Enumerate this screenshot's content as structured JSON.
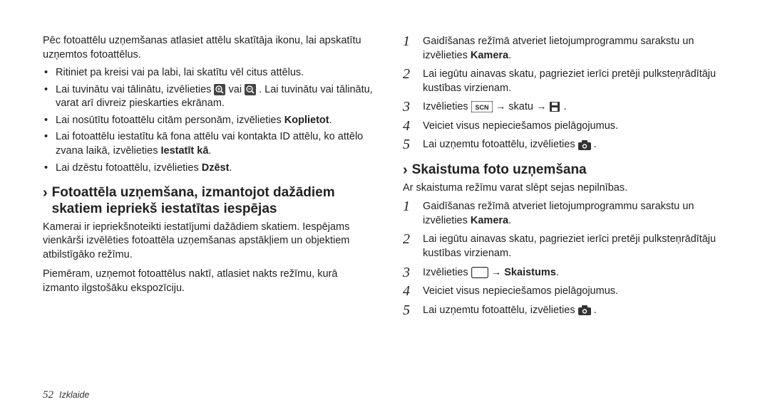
{
  "left": {
    "intro": "Pēc fotoattēlu uzņemšanas atlasiet attēlu skatītāja ikonu, lai apskatītu uzņemtos fotoattēlus.",
    "bullets": {
      "b1": "Ritiniet pa kreisi vai pa labi, lai skatītu vēl citus attēlus.",
      "b2a": "Lai tuvinātu vai tālinātu, izvēlieties ",
      "b2b": " vai ",
      "b2c": ". Lai tuvinātu vai tālinātu, varat arī divreiz pieskarties ekrānam.",
      "b3a": "Lai nosūtītu fotoattēlu citām personām, izvēlieties ",
      "b3b": "Koplietot",
      "b3c": ".",
      "b4a": "Lai fotoattēlu iestatītu kā fona attēlu vai kontakta ID attēlu, ko attēlo zvana laikā, izvēlieties ",
      "b4b": "Iestatīt kā",
      "b4c": ".",
      "b5a": "Lai dzēstu fotoattēlu, izvēlieties ",
      "b5b": "Dzēst",
      "b5c": "."
    },
    "subhead": "Fotoattēla uzņemšana, izmantojot dažādiem skatiem iepriekš iestatītas iespējas",
    "after1": "Kamerai ir iepriekšnoteikti iestatījumi dažādiem skatiem. Iespējams vienkārši izvēlēties fotoattēla uzņemšanas apstākļiem un objektiem atbilstīgāko režīmu.",
    "after2": "Piemēram, uzņemot fotoattēlus naktī, atlasiet nakts režīmu, kurā izmanto ilgstošāku ekspozīciju."
  },
  "right": {
    "stepsA": {
      "s1a": "Gaidīšanas režīmā atveriet lietojumprogrammu sarakstu un izvēlieties ",
      "s1b": "Kamera",
      "s1c": ".",
      "s2": "Lai iegūtu ainavas skatu, pagrieziet ierīci pretēji pulksteņrādītāju kustības virzienam.",
      "s3a": "Izvēlieties ",
      "s3b": " → skatu → ",
      "s3c": ".",
      "s4": "Veiciet visus nepieciešamos pielāgojumus.",
      "s5a": "Lai uzņemtu fotoattēlu, izvēlieties ",
      "s5b": "."
    },
    "subhead": "Skaistuma foto uzņemšana",
    "beauty_intro": "Ar skaistuma režīmu varat slēpt sejas nepilnības.",
    "stepsB": {
      "s1a": "Gaidīšanas režīmā atveriet lietojumprogrammu sarakstu un izvēlieties ",
      "s1b": "Kamera",
      "s1c": ".",
      "s2": "Lai iegūtu ainavas skatu, pagrieziet ierīci pretēji pulksteņrādītāju kustības virzienam.",
      "s3a": "Izvēlieties ",
      "s3b": " → ",
      "s3c": "Skaistums",
      "s3d": ".",
      "s4": "Veiciet visus nepieciešamos pielāgojumus.",
      "s5a": "Lai uzņemtu fotoattēlu, izvēlieties ",
      "s5b": "."
    }
  },
  "footer": {
    "page": "52",
    "section": "Izklaide"
  },
  "nums": {
    "n1": "1",
    "n2": "2",
    "n3": "3",
    "n4": "4",
    "n5": "5"
  }
}
